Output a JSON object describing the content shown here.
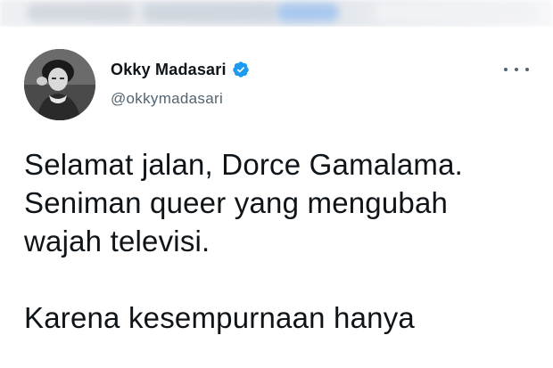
{
  "author": {
    "display_name": "Okky Madasari",
    "handle": "@okkymadasari",
    "verified": true,
    "avatar_icon": "profile-photo"
  },
  "menu": {
    "icon": "more-horizontal-icon"
  },
  "tweet": {
    "lines": [
      "Selamat jalan, Dorce Gamalama.",
      "Seniman queer yang mengubah",
      "wajah televisi.",
      "",
      "Karena kesempurnaan hanya"
    ]
  },
  "colors": {
    "verified_badge": "#1d9bf0",
    "name_text": "#0f1419",
    "handle_text": "#536471"
  }
}
